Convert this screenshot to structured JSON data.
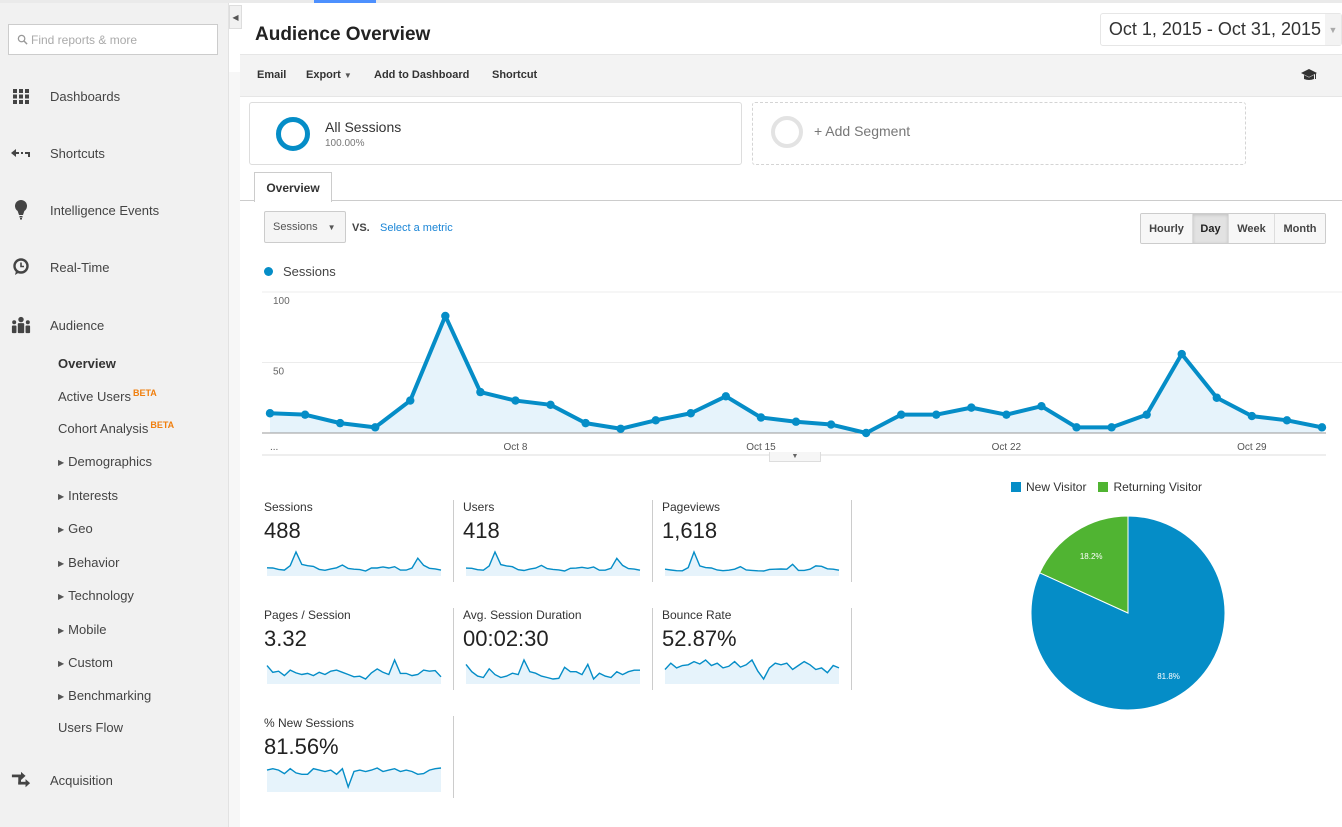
{
  "sidebar": {
    "search_placeholder": "Find reports & more",
    "nav": [
      {
        "label": "Dashboards",
        "icon": "dashboard-grid-icon"
      },
      {
        "label": "Shortcuts",
        "icon": "shortcut-arrow-icon"
      },
      {
        "label": "Intelligence Events",
        "icon": "lightbulb-icon"
      },
      {
        "label": "Real-Time",
        "icon": "clock-icon"
      },
      {
        "label": "Audience",
        "icon": "people-icon"
      },
      {
        "label": "Acquisition",
        "icon": "acquisition-arrows-icon"
      }
    ],
    "audience_sub": [
      {
        "label": "Overview",
        "active": true
      },
      {
        "label": "Active Users",
        "badge": "BETA"
      },
      {
        "label": "Cohort Analysis",
        "badge": "BETA"
      },
      {
        "label": "Demographics",
        "expandable": true
      },
      {
        "label": "Interests",
        "expandable": true
      },
      {
        "label": "Geo",
        "expandable": true
      },
      {
        "label": "Behavior",
        "expandable": true
      },
      {
        "label": "Technology",
        "expandable": true
      },
      {
        "label": "Mobile",
        "expandable": true
      },
      {
        "label": "Custom",
        "expandable": true
      },
      {
        "label": "Benchmarking",
        "expandable": true
      },
      {
        "label": "Users Flow"
      }
    ]
  },
  "header": {
    "title": "Audience Overview",
    "date_range": "Oct 1, 2015 - Oct 31, 2015"
  },
  "toolbar": {
    "email": "Email",
    "export": "Export",
    "add_to_dashboard": "Add to Dashboard",
    "shortcut": "Shortcut"
  },
  "segments": {
    "all_sessions": {
      "name": "All Sessions",
      "percent": "100.00%"
    },
    "add_segment": "+ Add Segment"
  },
  "tabs": {
    "overview": "Overview"
  },
  "controls": {
    "metric": "Sessions",
    "vs": "VS.",
    "select_metric": "Select a metric",
    "granularity": [
      {
        "label": "Hourly",
        "active": false
      },
      {
        "label": "Day",
        "active": true
      },
      {
        "label": "Week",
        "active": false
      },
      {
        "label": "Month",
        "active": false
      }
    ]
  },
  "colors": {
    "primary": "#058dc7",
    "fill": "#e6f3fb",
    "returning": "#50b432",
    "beta": "#f07f0e",
    "link": "#1a85d6"
  },
  "chart_data": [
    {
      "type": "area",
      "title": "",
      "legend": [
        "Sessions"
      ],
      "legend_placement": "top-left",
      "x": [
        "Oct 1",
        "Oct 2",
        "Oct 3",
        "Oct 4",
        "Oct 5",
        "Oct 6",
        "Oct 7",
        "Oct 8",
        "Oct 9",
        "Oct 10",
        "Oct 11",
        "Oct 12",
        "Oct 13",
        "Oct 14",
        "Oct 15",
        "Oct 16",
        "Oct 17",
        "Oct 18",
        "Oct 19",
        "Oct 20",
        "Oct 21",
        "Oct 22",
        "Oct 23",
        "Oct 24",
        "Oct 25",
        "Oct 26",
        "Oct 27",
        "Oct 28",
        "Oct 29",
        "Oct 30",
        "Oct 31"
      ],
      "series": [
        {
          "name": "Sessions",
          "values": [
            14,
            13,
            7,
            4,
            23,
            83,
            29,
            23,
            20,
            7,
            3,
            9,
            14,
            26,
            11,
            8,
            6,
            0,
            13,
            13,
            18,
            13,
            19,
            4,
            4,
            13,
            56,
            25,
            12,
            9,
            4
          ]
        }
      ],
      "x_tick_labels": [
        "...",
        "Oct 8",
        "Oct 15",
        "Oct 22",
        "Oct 29"
      ],
      "y_tick_labels": [
        "100",
        "50"
      ],
      "ylim": [
        0,
        100
      ],
      "grid": true
    },
    {
      "type": "pie",
      "legend": [
        "New Visitor",
        "Returning Visitor"
      ],
      "legend_placement": "top",
      "slices": [
        {
          "label": "New Visitor",
          "value": 81.8,
          "text": "81.8%"
        },
        {
          "label": "Returning Visitor",
          "value": 18.2,
          "text": "18.2%"
        }
      ]
    }
  ],
  "metrics": [
    {
      "label": "Sessions",
      "value": "488",
      "spark": [
        14,
        13,
        7,
        4,
        23,
        83,
        29,
        23,
        20,
        7,
        3,
        9,
        14,
        26,
        11,
        8,
        6,
        0,
        13,
        13,
        18,
        13,
        19,
        4,
        4,
        13,
        56,
        25,
        12,
        9,
        4
      ]
    },
    {
      "label": "Users",
      "value": "418",
      "spark": [
        12,
        11,
        6,
        4,
        20,
        72,
        25,
        20,
        17,
        6,
        3,
        8,
        12,
        22,
        10,
        7,
        5,
        1,
        11,
        12,
        15,
        11,
        16,
        4,
        4,
        11,
        48,
        22,
        10,
        8,
        4
      ]
    },
    {
      "label": "Pageviews",
      "value": "1,618",
      "spark": [
        40,
        30,
        22,
        20,
        60,
        250,
        80,
        60,
        55,
        30,
        22,
        28,
        40,
        70,
        30,
        25,
        20,
        18,
        38,
        40,
        42,
        40,
        100,
        25,
        25,
        40,
        80,
        75,
        45,
        40,
        28
      ]
    },
    {
      "label": "Pages / Session",
      "value": "3.32",
      "spark": [
        4.8,
        3.6,
        3.8,
        3.0,
        4.0,
        3.5,
        3.2,
        3.4,
        3.0,
        3.6,
        3.2,
        3.8,
        4.0,
        3.6,
        3.2,
        2.8,
        2.9,
        2.4,
        3.5,
        4.2,
        3.6,
        3.2,
        5.8,
        3.4,
        3.4,
        3.0,
        3.2,
        4.0,
        3.8,
        3.9,
        2.8
      ]
    },
    {
      "label": "Avg. Session Duration",
      "value": "00:02:30",
      "spark": [
        200,
        150,
        120,
        110,
        170,
        130,
        110,
        120,
        140,
        130,
        230,
        150,
        140,
        120,
        110,
        100,
        105,
        180,
        150,
        150,
        130,
        200,
        100,
        140,
        120,
        110,
        150,
        130,
        150,
        160,
        160
      ]
    },
    {
      "label": "Bounce Rate",
      "value": "52.87%",
      "spark": [
        50,
        58,
        52,
        55,
        56,
        60,
        57,
        62,
        55,
        58,
        52,
        54,
        60,
        53,
        56,
        62,
        48,
        38,
        52,
        58,
        56,
        58,
        50,
        55,
        60,
        56,
        50,
        52,
        46,
        55,
        52
      ]
    },
    {
      "label": "% New Sessions",
      "value": "81.56%",
      "spark": [
        80,
        82,
        80,
        75,
        82,
        76,
        74,
        74,
        82,
        80,
        78,
        80,
        74,
        82,
        56,
        78,
        80,
        78,
        80,
        83,
        78,
        80,
        82,
        78,
        80,
        78,
        74,
        75,
        80,
        82,
        83
      ]
    }
  ]
}
